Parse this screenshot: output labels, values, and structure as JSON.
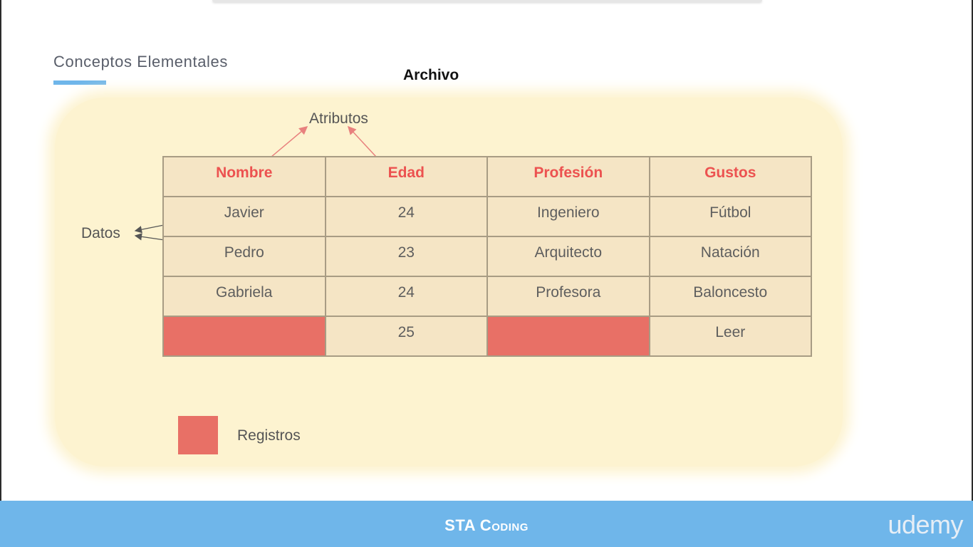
{
  "header": {
    "section_title": "Conceptos Elementales",
    "file_title": "Archivo"
  },
  "diagram": {
    "attributes_label": "Atributos",
    "data_label": "Datos",
    "columns": [
      "Nombre",
      "Edad",
      "Profesión",
      "Gustos"
    ],
    "rows": [
      [
        "Javier",
        "24",
        "Ingeniero",
        "Fútbol"
      ],
      [
        "Pedro",
        "23",
        "Arquitecto",
        "Natación"
      ],
      [
        "Gabriela",
        "24",
        "Profesora",
        "Baloncesto"
      ],
      [
        "",
        "25",
        "",
        "Leer"
      ]
    ],
    "legend_label": "Registros"
  },
  "footer": {
    "brand": "STA Coding",
    "logo": "udemy"
  },
  "colors": {
    "accent_blue": "#6fb6ea",
    "header_red": "#ec5250",
    "record_red": "#e87066",
    "panel_cream": "#fdf3d0"
  }
}
